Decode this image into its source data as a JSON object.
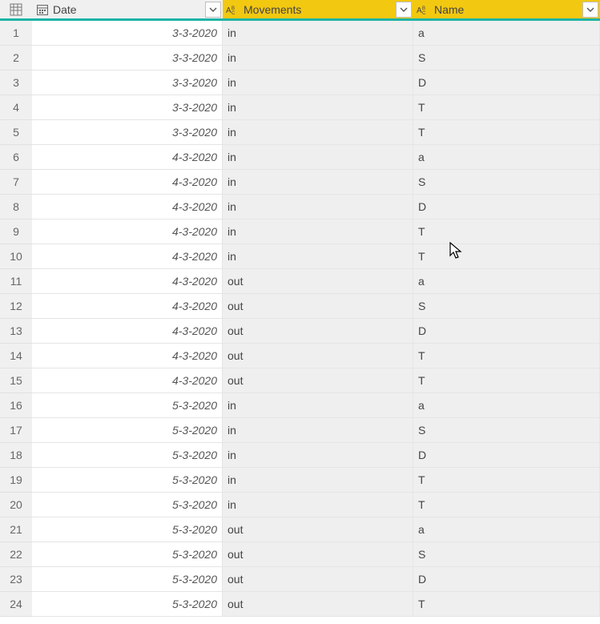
{
  "columns": [
    {
      "name": "Date",
      "type": "date",
      "selected": false
    },
    {
      "name": "Movements",
      "type": "text",
      "selected": true
    },
    {
      "name": "Name",
      "type": "text",
      "selected": true
    }
  ],
  "rows": [
    {
      "n": "1",
      "date": "3-3-2020",
      "movements": "in",
      "name": "a"
    },
    {
      "n": "2",
      "date": "3-3-2020",
      "movements": "in",
      "name": "S"
    },
    {
      "n": "3",
      "date": "3-3-2020",
      "movements": "in",
      "name": "D"
    },
    {
      "n": "4",
      "date": "3-3-2020",
      "movements": "in",
      "name": "T"
    },
    {
      "n": "5",
      "date": "3-3-2020",
      "movements": "in",
      "name": "T"
    },
    {
      "n": "6",
      "date": "4-3-2020",
      "movements": "in",
      "name": "a"
    },
    {
      "n": "7",
      "date": "4-3-2020",
      "movements": "in",
      "name": "S"
    },
    {
      "n": "8",
      "date": "4-3-2020",
      "movements": "in",
      "name": "D"
    },
    {
      "n": "9",
      "date": "4-3-2020",
      "movements": "in",
      "name": "T"
    },
    {
      "n": "10",
      "date": "4-3-2020",
      "movements": "in",
      "name": "T"
    },
    {
      "n": "11",
      "date": "4-3-2020",
      "movements": "out",
      "name": "a"
    },
    {
      "n": "12",
      "date": "4-3-2020",
      "movements": "out",
      "name": "S"
    },
    {
      "n": "13",
      "date": "4-3-2020",
      "movements": "out",
      "name": "D"
    },
    {
      "n": "14",
      "date": "4-3-2020",
      "movements": "out",
      "name": "T"
    },
    {
      "n": "15",
      "date": "4-3-2020",
      "movements": "out",
      "name": "T"
    },
    {
      "n": "16",
      "date": "5-3-2020",
      "movements": "in",
      "name": "a"
    },
    {
      "n": "17",
      "date": "5-3-2020",
      "movements": "in",
      "name": "S"
    },
    {
      "n": "18",
      "date": "5-3-2020",
      "movements": "in",
      "name": "D"
    },
    {
      "n": "19",
      "date": "5-3-2020",
      "movements": "in",
      "name": "T"
    },
    {
      "n": "20",
      "date": "5-3-2020",
      "movements": "in",
      "name": "T"
    },
    {
      "n": "21",
      "date": "5-3-2020",
      "movements": "out",
      "name": "a"
    },
    {
      "n": "22",
      "date": "5-3-2020",
      "movements": "out",
      "name": "S"
    },
    {
      "n": "23",
      "date": "5-3-2020",
      "movements": "out",
      "name": "D"
    },
    {
      "n": "24",
      "date": "5-3-2020",
      "movements": "out",
      "name": "T"
    }
  ]
}
